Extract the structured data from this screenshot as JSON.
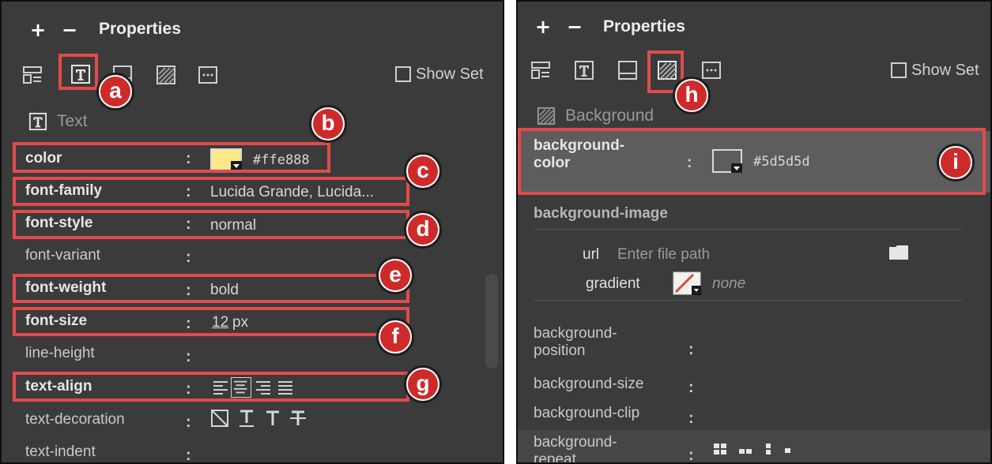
{
  "left_panel": {
    "header": {
      "plus": "+",
      "minus": "−",
      "title": "Properties"
    },
    "show_set": "Show Set",
    "section": "Text",
    "rows": {
      "color": {
        "label": "color",
        "value": "#ffe888"
      },
      "font_family": {
        "label": "font-family",
        "value": "Lucida Grande, Lucida..."
      },
      "font_style": {
        "label": "font-style",
        "value": "normal"
      },
      "font_variant": {
        "label": "font-variant",
        "value": ""
      },
      "font_weight": {
        "label": "font-weight",
        "value": "bold"
      },
      "font_size": {
        "label": "font-size",
        "value": "12",
        "unit": "px"
      },
      "line_height": {
        "label": "line-height"
      },
      "text_align": {
        "label": "text-align"
      },
      "text_decoration": {
        "label": "text-decoration"
      },
      "text_indent": {
        "label": "text-indent"
      }
    },
    "colon": ":",
    "callouts": {
      "a": "a",
      "b": "b",
      "c": "c",
      "d": "d",
      "e": "e",
      "f": "f",
      "g": "g"
    }
  },
  "right_panel": {
    "header": {
      "plus": "+",
      "minus": "−",
      "title": "Properties"
    },
    "show_set": "Show Set",
    "section": "Background",
    "background_color": {
      "label_line1": "background-",
      "label_line2": "color",
      "value": "#5d5d5d"
    },
    "background_image": {
      "title": "background-image",
      "url_label": "url",
      "url_placeholder": "Enter file path",
      "gradient_label": "gradient",
      "gradient_value": "none"
    },
    "background_position": {
      "label_line1": "background-",
      "label_line2": "position"
    },
    "background_size": {
      "label": "background-size"
    },
    "background_clip": {
      "label": "background-clip"
    },
    "background_repeat": {
      "label_line1": "background-",
      "label_line2": "repeat"
    },
    "colon": ":",
    "callouts": {
      "h": "h",
      "i": "i"
    }
  },
  "colors": {
    "panel_bg": "#3b3b3b",
    "highlight_row": "#5d5d5d",
    "callout_red": "#e34a4a",
    "badge_red": "#cf2a2a",
    "text_color_swatch": "#ffe888",
    "bg_color_swatch": "#5d5d5d"
  },
  "icons": [
    "layout-icon",
    "text-icon",
    "box-icon",
    "background-icon",
    "more-icon",
    "folder-icon",
    "gradient-icon",
    "align-left-icon",
    "align-center-icon",
    "align-right-icon",
    "align-justify-icon",
    "decoration-none-icon",
    "underline-icon",
    "overline-icon",
    "strikethrough-icon",
    "repeat-icons"
  ]
}
